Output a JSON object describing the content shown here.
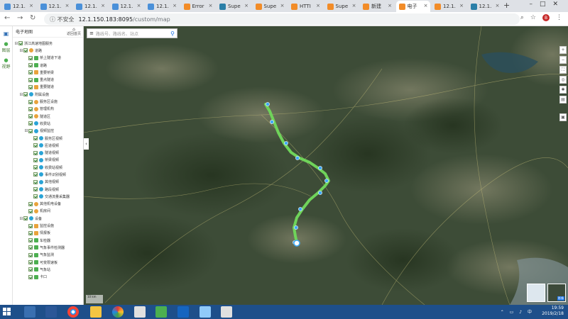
{
  "browser": {
    "tabs": [
      {
        "label": "12.1.",
        "fav": "blue"
      },
      {
        "label": "12.1.",
        "fav": "blue"
      },
      {
        "label": "12.1.",
        "fav": "blue"
      },
      {
        "label": "12.1.",
        "fav": "blue"
      },
      {
        "label": "12.1.",
        "fav": "blue"
      },
      {
        "label": "Error",
        "fav": "orange"
      },
      {
        "label": "Supe",
        "fav": "teal"
      },
      {
        "label": "Supe",
        "fav": "orange"
      },
      {
        "label": "HTTI",
        "fav": "orange"
      },
      {
        "label": "Supe",
        "fav": "orange"
      },
      {
        "label": "新建",
        "fav": "orange"
      },
      {
        "label": "电子",
        "fav": "orange",
        "active": true
      },
      {
        "label": "12.1.",
        "fav": "orange"
      },
      {
        "label": "12.1.",
        "fav": "teal"
      }
    ],
    "security_label": "不安全",
    "url_host": "12.1.150.183:8095",
    "url_path": "/custom/map",
    "profile_letter": "B"
  },
  "rail": {
    "items": [
      {
        "label": "图层",
        "icon": "layers-icon"
      },
      {
        "label": "视野",
        "icon": "view-icon"
      }
    ]
  },
  "panel": {
    "title": "电子地图",
    "back_label": "返回首页",
    "tree": [
      {
        "indent": 0,
        "toggle": "⊟",
        "icon": "none",
        "label": "浙江高速地图服务",
        "color": "#e8a33c"
      },
      {
        "indent": 1,
        "toggle": "⊟",
        "icon": "dot",
        "label": "道路",
        "color": "#e8a33c"
      },
      {
        "indent": 2,
        "toggle": "",
        "icon": "sq",
        "label": "桥上隧道下道",
        "color": "#4caf50"
      },
      {
        "indent": 2,
        "toggle": "",
        "icon": "sq",
        "label": "道路",
        "color": "#4caf50"
      },
      {
        "indent": 2,
        "toggle": "",
        "icon": "sq",
        "label": "重要桥梁",
        "color": "#e8a33c"
      },
      {
        "indent": 2,
        "toggle": "",
        "icon": "sq",
        "label": "重点隧道",
        "color": "#4caf50"
      },
      {
        "indent": 2,
        "toggle": "",
        "icon": "sq",
        "label": "重要隧道",
        "color": "#e8a33c"
      },
      {
        "indent": 1,
        "toggle": "⊟",
        "icon": "dot",
        "label": "附属设施",
        "color": "#29a3d6"
      },
      {
        "indent": 2,
        "toggle": "",
        "icon": "dot",
        "label": "服务区设施",
        "color": "#e8a33c"
      },
      {
        "indent": 2,
        "toggle": "",
        "icon": "dot",
        "label": "管理机构",
        "color": "#e8a33c"
      },
      {
        "indent": 2,
        "toggle": "",
        "icon": "dot",
        "label": "隧道区",
        "color": "#e8a33c"
      },
      {
        "indent": 2,
        "toggle": "",
        "icon": "dot",
        "label": "收费站",
        "color": "#29a3d6"
      },
      {
        "indent": 2,
        "toggle": "⊟",
        "icon": "dot",
        "label": "视频监控",
        "color": "#29a3d6"
      },
      {
        "indent": 3,
        "toggle": "",
        "icon": "dot",
        "label": "服务区视频",
        "color": "#29a3d6"
      },
      {
        "indent": 3,
        "toggle": "",
        "icon": "dot",
        "label": "匝道视频",
        "color": "#29a3d6"
      },
      {
        "indent": 3,
        "toggle": "",
        "icon": "dot",
        "label": "隧道视频",
        "color": "#29a3d6"
      },
      {
        "indent": 3,
        "toggle": "",
        "icon": "dot",
        "label": "桥梁视频",
        "color": "#29a3d6"
      },
      {
        "indent": 3,
        "toggle": "",
        "icon": "dot",
        "label": "收费站视频",
        "color": "#29a3d6"
      },
      {
        "indent": 3,
        "toggle": "",
        "icon": "dot",
        "label": "事件识别视频",
        "color": "#29a3d6"
      },
      {
        "indent": 3,
        "toggle": "",
        "icon": "dot",
        "label": "其他视频",
        "color": "#29a3d6"
      },
      {
        "indent": 3,
        "toggle": "",
        "icon": "dot",
        "label": "路段视频",
        "color": "#29a3d6"
      },
      {
        "indent": 3,
        "toggle": "",
        "icon": "dot",
        "label": "交通流量采集器",
        "color": "#29a3d6"
      },
      {
        "indent": 2,
        "toggle": "",
        "icon": "dot",
        "label": "其他机电设备",
        "color": "#e8a33c"
      },
      {
        "indent": 2,
        "toggle": "",
        "icon": "dot",
        "label": "机房间",
        "color": "#e8a33c"
      },
      {
        "indent": 1,
        "toggle": "⊟",
        "icon": "dot",
        "label": "设备",
        "color": "#29a3d6"
      },
      {
        "indent": 2,
        "toggle": "",
        "icon": "sq",
        "label": "监控设施",
        "color": "#e8a33c"
      },
      {
        "indent": 2,
        "toggle": "",
        "icon": "sq",
        "label": "情报板",
        "color": "#e8a33c"
      },
      {
        "indent": 2,
        "toggle": "",
        "icon": "sq",
        "label": "车检器",
        "color": "#4caf50"
      },
      {
        "indent": 2,
        "toggle": "",
        "icon": "sq",
        "label": "气象事件检测器",
        "color": "#4caf50"
      },
      {
        "indent": 2,
        "toggle": "",
        "icon": "sq",
        "label": "气象监测",
        "color": "#4caf50"
      },
      {
        "indent": 2,
        "toggle": "",
        "icon": "sq",
        "label": "可变限速板",
        "color": "#4caf50"
      },
      {
        "indent": 2,
        "toggle": "",
        "icon": "sq",
        "label": "气象站",
        "color": "#4caf50"
      },
      {
        "indent": 2,
        "toggle": "",
        "icon": "sq",
        "label": "卡口",
        "color": "#4caf50"
      }
    ]
  },
  "map": {
    "search_placeholder": "路线号、路线名、站点",
    "scale_text": "10 km",
    "basemap_label": "影像",
    "route_color": "#6fd35a",
    "marker_color": "#3fa9f5"
  },
  "taskbar": {
    "time": "19:59",
    "date": "2019/2/18"
  }
}
